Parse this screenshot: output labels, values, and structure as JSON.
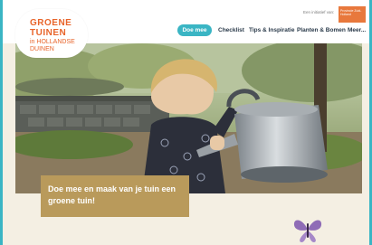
{
  "logo": {
    "line1": "GROENE",
    "line2": "TUINEN",
    "line3": "in HOLLANDSE",
    "line4": "DUINEN"
  },
  "header": {
    "tagline": "Een initiatief van:",
    "partner_text": "Provincie Zuid-Holland"
  },
  "nav": {
    "items": [
      {
        "label": "Doe mee",
        "active": true
      },
      {
        "label": "Checklist"
      },
      {
        "label": "Tips & Inspiratie"
      },
      {
        "label": "Planten & Bomen"
      },
      {
        "label": "Meer..."
      }
    ]
  },
  "hero": {
    "image": "child watering garden with metal watering can",
    "caption": "Doe mee en maak van je tuin een groene tuin!"
  },
  "colors": {
    "accent": "#3ab5c4",
    "brand_orange": "#e8642a",
    "caption_bg": "#b99a5b",
    "butterfly": "#8f6cb6"
  }
}
